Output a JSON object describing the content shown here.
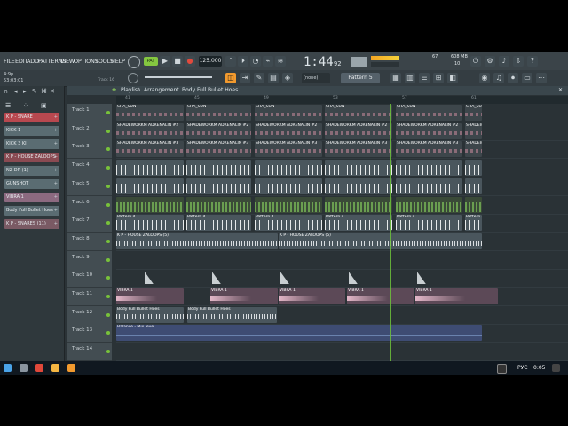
{
  "menu": [
    "FILE",
    "EDIT",
    "ADD",
    "PATTERNS",
    "VIEW",
    "OPTIONS",
    "TOOLS",
    "HELP"
  ],
  "transport": {
    "tempo": "125.000",
    "time": "1:44",
    "time_small": "92",
    "mode": "PAT"
  },
  "hint_bar": {
    "line1": "4:9p",
    "line2": "53:03:01",
    "track_label": "Track 16"
  },
  "snap": {
    "value": "(none)"
  },
  "pattern_selector": {
    "label": "Pattern 5"
  },
  "cpu": {
    "value": "67",
    "mem": "608 MB",
    "polyphony": "10"
  },
  "breadcrumb": {
    "playlist": "Playlist",
    "arrangement": "Arrangement",
    "sep1": "›",
    "sep2": "›",
    "clip": "Body Full",
    "clip2": "Bullet Hoes"
  },
  "picker": [
    {
      "label": "K P - SNARE",
      "color": "#b8484f"
    },
    {
      "label": "KICK 1",
      "color": "#5a6c72"
    },
    {
      "label": "KICK 3 KI",
      "color": "#5a6c72"
    },
    {
      "label": "K P - HOUSE ZALOOPS",
      "color": "#8a4a52"
    },
    {
      "label": "NZ DR (1)",
      "color": "#5a6c72"
    },
    {
      "label": "GUNSHOT",
      "color": "#5a6c72"
    },
    {
      "label": "VIBRA 1",
      "color": "#8c6a80"
    },
    {
      "label": "Body Full  Bullet Hoes",
      "color": "#5a6c72"
    },
    {
      "label": "K P - SNARES (11)",
      "color": "#7a5a64"
    }
  ],
  "ruler": [
    "41",
    "45",
    "49",
    "53",
    "57",
    "61"
  ],
  "tracks": [
    {
      "name": "Track 1",
      "clips": [
        {
          "label": "SHA_SON",
          "kind": "pink"
        }
      ]
    },
    {
      "name": "Track 2",
      "clips": [
        {
          "label": "SHADEWORKM  ADRENALIN #2",
          "kind": "pink"
        }
      ]
    },
    {
      "name": "Track 3",
      "clips": [
        {
          "label": "SHADEWORKM  ADRENALIN #3",
          "kind": "pink"
        }
      ]
    },
    {
      "name": "Track 4",
      "clips": [
        {
          "label": "",
          "kind": "gray"
        }
      ]
    },
    {
      "name": "Track 5",
      "clips": [
        {
          "label": "",
          "kind": "gray"
        }
      ]
    },
    {
      "name": "Track 6",
      "clips": [
        {
          "label": "",
          "kind": "green"
        }
      ]
    },
    {
      "name": "Track 7",
      "clips": [
        {
          "label": "Pattern 4",
          "kind": "gray"
        }
      ]
    },
    {
      "name": "Track 8",
      "clips": [
        {
          "label": "K P - HOUSE ZALOOPS (5)",
          "kind": "wave"
        }
      ]
    },
    {
      "name": "Track 9",
      "clips": []
    },
    {
      "name": "Track 10",
      "clips": [
        {
          "label": "",
          "kind": "hit"
        }
      ]
    },
    {
      "name": "Track 11",
      "clips": [
        {
          "label": "VIBRA 1",
          "kind": "vibra"
        }
      ]
    },
    {
      "name": "Track 12",
      "clips": [
        {
          "label": "Body Full  Bullet Hoes",
          "kind": "wave"
        }
      ]
    },
    {
      "name": "Track 13",
      "clips": [
        {
          "label": "Balance - Mix level",
          "kind": "auto"
        }
      ]
    },
    {
      "name": "Track 14",
      "clips": []
    }
  ],
  "taskbar": {
    "lang": "РУС",
    "clock": "0:05"
  },
  "colors": {
    "pink": "#c98a9c",
    "green": "#7fc25a",
    "playhead": "#6dc23a",
    "accent": "#f29a2e"
  }
}
